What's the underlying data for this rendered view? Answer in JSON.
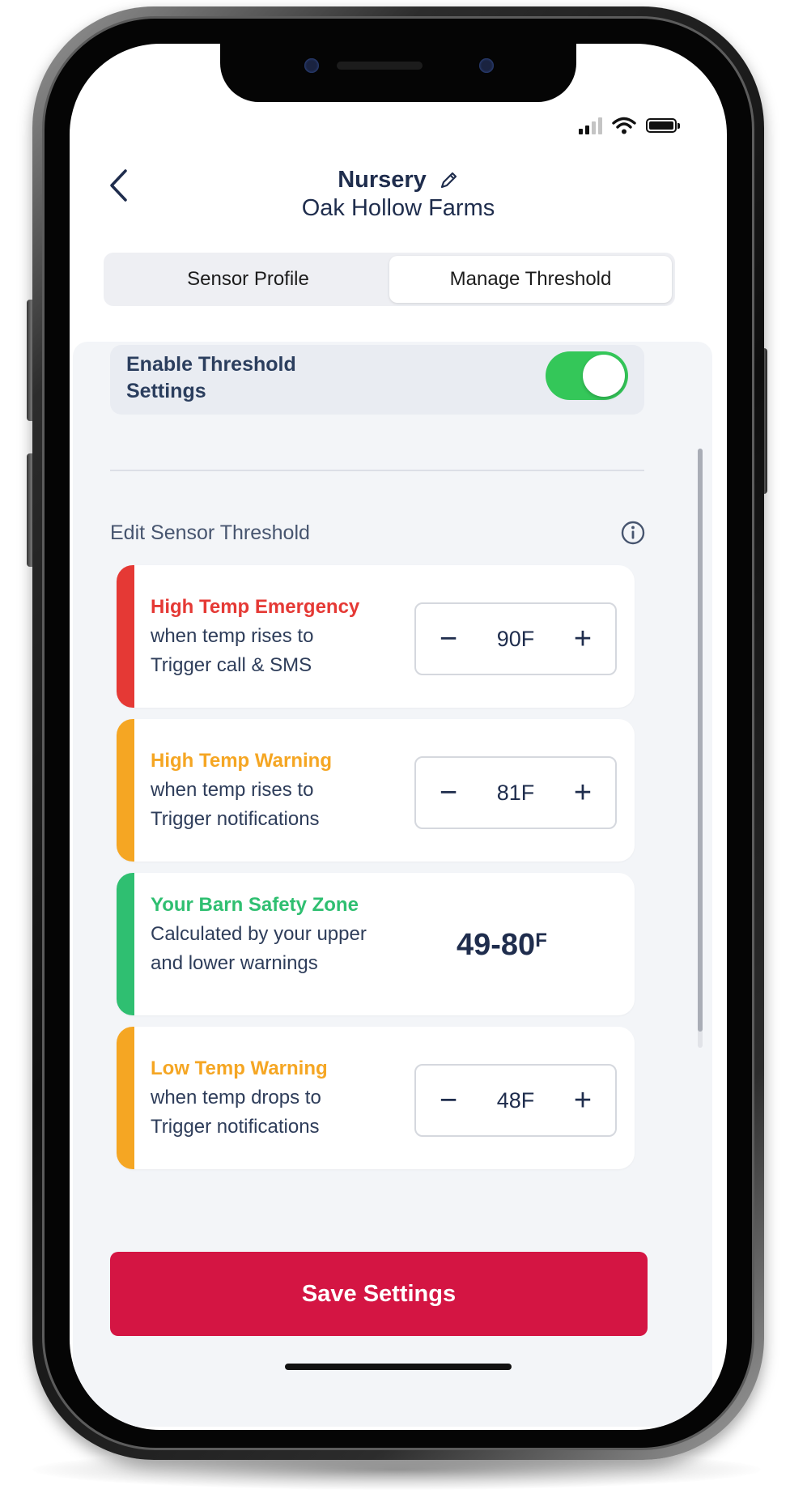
{
  "status_bar": {
    "signal_icon": "cellular-signal-icon",
    "wifi_icon": "wifi-icon",
    "battery_icon": "battery-icon"
  },
  "header": {
    "back_icon": "chevron-left-icon",
    "title": "Nursery",
    "edit_icon": "pencil-icon",
    "subtitle": "Oak Hollow Farms"
  },
  "tabs": [
    {
      "label": "Sensor Profile",
      "active": false
    },
    {
      "label": "Manage Threshold",
      "active": true
    }
  ],
  "threshold_toggle": {
    "label": "Enable Threshold Settings",
    "enabled": true,
    "color": "#34c759"
  },
  "section": {
    "label": "Edit Sensor Threshold",
    "info_icon": "info-icon"
  },
  "cards": {
    "high_emergency": {
      "title": "High Temp Emergency",
      "line1": "when temp rises to",
      "line2": "Trigger call & SMS",
      "value": "90F",
      "color": "#e53935"
    },
    "high_warning": {
      "title": "High Temp Warning",
      "line1": "when temp rises to",
      "line2": "Trigger notifications",
      "value": "81F",
      "color": "#f5a623"
    },
    "safety_zone": {
      "title": "Your Barn Safety Zone",
      "line1": "Calculated by your upper",
      "line2": "and lower warnings",
      "range": "49-80",
      "unit": "F",
      "color": "#2fbf71"
    },
    "low_warning": {
      "title": "Low Temp Warning",
      "line1": "when temp drops to",
      "line2": "Trigger notifications",
      "value": "48F",
      "color": "#f5a623"
    }
  },
  "stepper": {
    "minus": "−",
    "plus": "+"
  },
  "save_button": {
    "label": "Save Settings",
    "color": "#d41543"
  }
}
